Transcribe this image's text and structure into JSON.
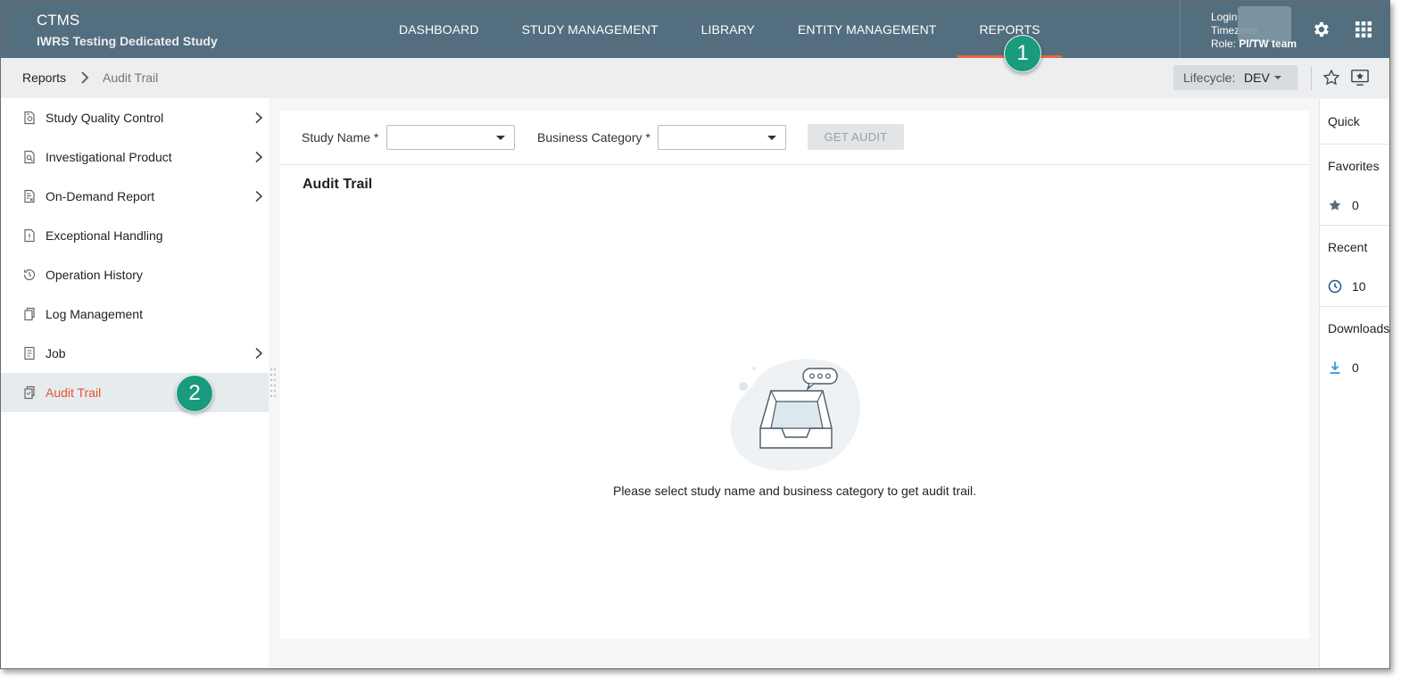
{
  "app": {
    "name": "CTMS",
    "study": "IWRS Testing Dedicated Study"
  },
  "nav": {
    "items": [
      "DASHBOARD",
      "STUDY MANAGEMENT",
      "LIBRARY",
      "ENTITY MANAGEMENT",
      "REPORTS"
    ],
    "active": "REPORTS"
  },
  "user": {
    "login_label": "Login",
    "timezone_label": "Timezone",
    "role_label": "Role:",
    "role_value": "PI/TW team"
  },
  "breadcrumb": {
    "root": "Reports",
    "current": "Audit Trail"
  },
  "lifecycle": {
    "label": "Lifecycle:",
    "value": "DEV"
  },
  "sidebar": {
    "items": [
      {
        "label": "Study Quality Control",
        "icon": "quality-doc-icon",
        "has_children": true
      },
      {
        "label": "Investigational Product",
        "icon": "product-doc-icon",
        "has_children": true
      },
      {
        "label": "On-Demand Report",
        "icon": "report-doc-icon",
        "has_children": true
      },
      {
        "label": "Exceptional Handling",
        "icon": "file-alert-icon",
        "has_children": false
      },
      {
        "label": "Operation History",
        "icon": "history-icon",
        "has_children": false
      },
      {
        "label": "Log Management",
        "icon": "copy-doc-icon",
        "has_children": false
      },
      {
        "label": "Job",
        "icon": "job-doc-icon",
        "has_children": true
      },
      {
        "label": "Audit Trail",
        "icon": "audit-doc-icon",
        "has_children": false,
        "active": true
      }
    ]
  },
  "filters": {
    "study_name_label": "Study Name *",
    "study_name_value": "",
    "business_category_label": "Business Category *",
    "business_category_value": "",
    "get_audit_label": "GET AUDIT"
  },
  "main": {
    "title": "Audit Trail",
    "empty_message": "Please select study name and business category to get audit trail."
  },
  "quick": {
    "title": "Quick",
    "favorites_label": "Favorites",
    "favorites_count": "0",
    "recent_label": "Recent",
    "recent_count": "10",
    "downloads_label": "Downloads",
    "downloads_count": "0"
  },
  "callouts": {
    "one": "1",
    "two": "2"
  },
  "colors": {
    "header_bg": "#536e7e",
    "accent": "#e5532e",
    "callout": "#1a9b7d",
    "download_blue": "#2f9be0"
  }
}
